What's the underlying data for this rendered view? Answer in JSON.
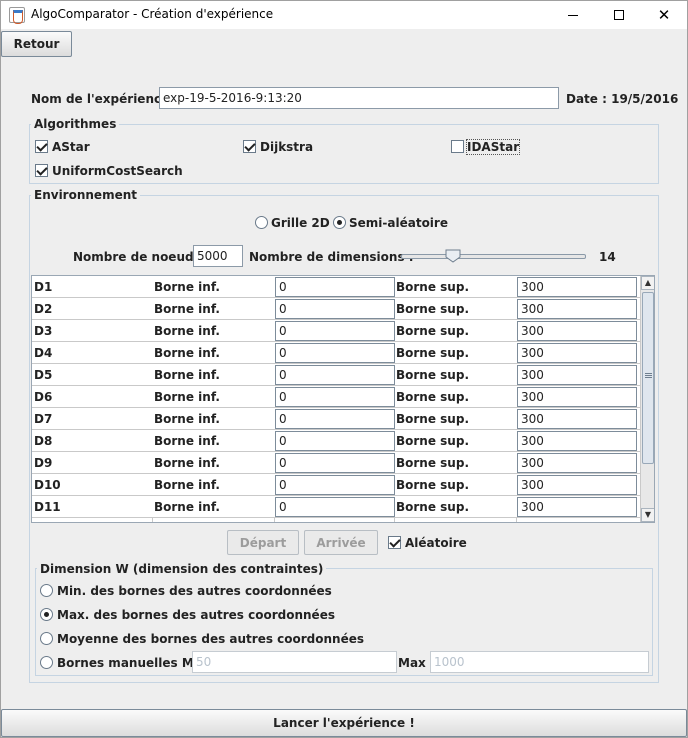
{
  "window": {
    "title": "AlgoComparator - Création d'expérience",
    "minimize_icon": "minimize-icon",
    "maximize_icon": "maximize-icon",
    "close_icon": "close-icon"
  },
  "toolbar": {
    "back_label": "Retour"
  },
  "experience": {
    "name_label": "Nom de l'expérience :",
    "name_value": "exp-19-5-2016-9:13:20",
    "date_label": "Date : 19/5/2016"
  },
  "algorithms": {
    "title": "Algorithmes",
    "items": [
      {
        "label": "AStar",
        "checked": true
      },
      {
        "label": "Dijkstra",
        "checked": true
      },
      {
        "label": "IDAStar",
        "checked": false
      },
      {
        "label": "UniformCostSearch",
        "checked": true
      }
    ]
  },
  "environment": {
    "title": "Environnement",
    "mode_options": [
      {
        "label": "Grille 2D",
        "selected": false
      },
      {
        "label": "Semi-aléatoire",
        "selected": true
      }
    ],
    "nodes_label": "Nombre de noeuds :",
    "nodes_value": "5000",
    "dimensions_label": "Nombre de dimensions :",
    "dimensions_value": "14",
    "dimensions_slider_fraction": 0.28,
    "table": {
      "binf_label": "Borne inf.",
      "bsup_label": "Borne sup.",
      "rows": [
        {
          "dim": "D1",
          "inf": "0",
          "sup": "300"
        },
        {
          "dim": "D2",
          "inf": "0",
          "sup": "300"
        },
        {
          "dim": "D3",
          "inf": "0",
          "sup": "300"
        },
        {
          "dim": "D4",
          "inf": "0",
          "sup": "300"
        },
        {
          "dim": "D5",
          "inf": "0",
          "sup": "300"
        },
        {
          "dim": "D6",
          "inf": "0",
          "sup": "300"
        },
        {
          "dim": "D7",
          "inf": "0",
          "sup": "300"
        },
        {
          "dim": "D8",
          "inf": "0",
          "sup": "300"
        },
        {
          "dim": "D9",
          "inf": "0",
          "sup": "300"
        },
        {
          "dim": "D10",
          "inf": "0",
          "sup": "300"
        },
        {
          "dim": "D11",
          "inf": "0",
          "sup": "300"
        }
      ]
    },
    "start_label": "Départ",
    "end_label": "Arrivée",
    "random_label": "Aléatoire",
    "random_checked": true
  },
  "dimension_w": {
    "title": "Dimension W (dimension des contraintes)",
    "options": [
      {
        "label": "Min. des bornes des autres coordonnées",
        "selected": false
      },
      {
        "label": "Max. des bornes des autres coordonnées",
        "selected": true
      },
      {
        "label": "Moyenne des bornes des autres coordonnées",
        "selected": false
      },
      {
        "label": "Bornes manuelles Min :",
        "selected": false
      }
    ],
    "min_value": "50",
    "max_label": "Max :",
    "max_value": "1000"
  },
  "launch_label": "Lancer l'expérience !"
}
